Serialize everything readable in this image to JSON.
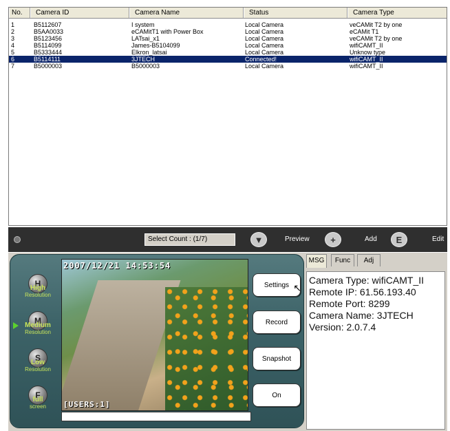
{
  "camera_list": {
    "columns": [
      "No.",
      "Camera ID",
      "Camera Name",
      "Status",
      "Camera Type"
    ],
    "rows": [
      {
        "no": "1",
        "id": "B5112607",
        "name": "I system",
        "status": "Local Camera",
        "type": "veCAMit T2 by one"
      },
      {
        "no": "2",
        "id": "B5AA0033",
        "name": "eCAMitT1 with Power Box",
        "status": "Local Camera",
        "type": "eCAMit T1"
      },
      {
        "no": "3",
        "id": "B5123456",
        "name": "LATsai_x1",
        "status": "Local Camera",
        "type": "veCAMit T2 by one"
      },
      {
        "no": "4",
        "id": "B5114099",
        "name": "James-B5104099",
        "status": "Local Camera",
        "type": "wifiCAMT_II"
      },
      {
        "no": "5",
        "id": "B5333444",
        "name": "Elkron_latsai",
        "status": "Local Camera",
        "type": "Unknow type"
      },
      {
        "no": "6",
        "id": "B5114111",
        "name": "3JTECH",
        "status": "Connected!",
        "type": "wifiCAMT_II",
        "selected": true
      },
      {
        "no": "7",
        "id": "B5000003",
        "name": "B5000003",
        "status": "Local Camera",
        "type": "wifiCAMT_II"
      }
    ]
  },
  "control_bar": {
    "select_count": "Select Count : (1/7)",
    "preview_label": "Preview",
    "add_label": "Add",
    "edit_label": "Edit"
  },
  "video": {
    "timestamp": "2007/12/21 14:53:54",
    "users_overlay": "[USERS:1]"
  },
  "resolution_buttons": [
    {
      "letter": "H",
      "line1": "High",
      "line2": "Resolution"
    },
    {
      "letter": "M",
      "line1": "Medium",
      "line2": "Resolution",
      "active": true
    },
    {
      "letter": "S",
      "line1": "Low",
      "line2": "Resolution"
    },
    {
      "letter": "F",
      "line1": "full",
      "line2": "screen"
    }
  ],
  "side_buttons": {
    "settings": "Settings",
    "record": "Record",
    "snapshot": "Snapshot",
    "on": "On"
  },
  "info_tabs": [
    "MSG",
    "Func",
    "Adj"
  ],
  "info_panel": {
    "camera_type": "Camera Type: wifiCAMT_II",
    "remote_ip": "Remote IP: 61.56.193.40",
    "remote_port": "Remote Port: 8299",
    "camera_name": "Camera Name: 3JTECH",
    "version": "Version: 2.0.7.4"
  },
  "colors": {
    "selection": "#0a246a",
    "panel": "#3d6368",
    "control_bar": "#2f2f2f",
    "label_green": "#c8e45a"
  }
}
